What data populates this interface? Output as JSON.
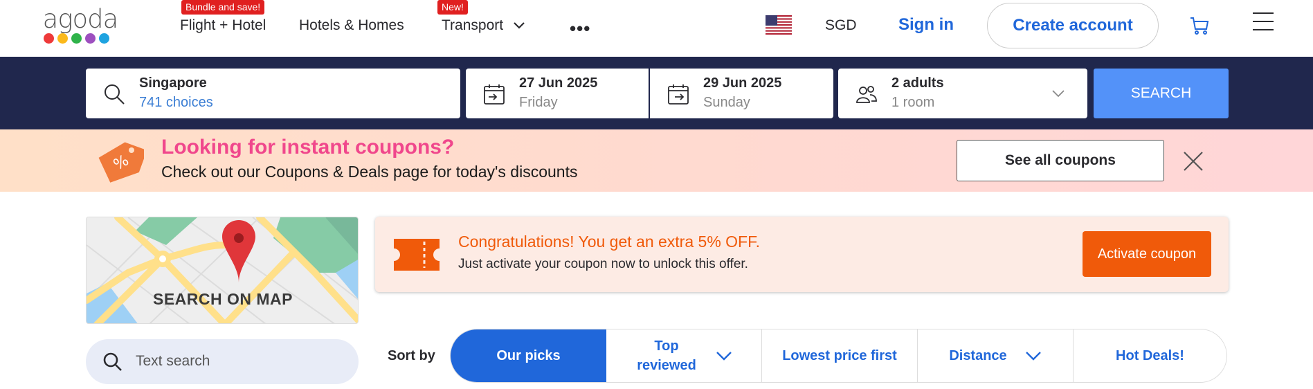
{
  "header": {
    "logo_text": "agoda",
    "logo_dot_colors": [
      "#ee3a3a",
      "#fbb91b",
      "#2fb34a",
      "#9d4fbf",
      "#1ea3e0"
    ],
    "nav": [
      {
        "label": "Flight + Hotel",
        "badge": "Bundle and save!"
      },
      {
        "label": "Hotels & Homes"
      },
      {
        "label": "Transport",
        "badge": "New!"
      }
    ],
    "more_label": "•••",
    "currency": "SGD",
    "sign_in": "Sign in",
    "create_account": "Create account"
  },
  "search": {
    "destination": "Singapore",
    "destination_sub": "741 choices",
    "checkin_date": "27 Jun 2025",
    "checkin_day": "Friday",
    "checkout_date": "29 Jun 2025",
    "checkout_day": "Sunday",
    "guests": "2 adults",
    "rooms": "1 room",
    "button": "SEARCH"
  },
  "coupon_banner": {
    "heading": "Looking for instant coupons?",
    "text": "Check out our Coupons & Deals page for today's discounts",
    "button": "See all coupons"
  },
  "map": {
    "label": "SEARCH ON MAP"
  },
  "text_search": {
    "placeholder": "Text search"
  },
  "promo": {
    "heading": "Congratulations! You get an extra 5% OFF.",
    "text": "Just activate your coupon now to unlock this offer.",
    "button": "Activate coupon"
  },
  "sort": {
    "label": "Sort by",
    "tabs": [
      {
        "label": "Our picks",
        "active": true
      },
      {
        "label": "Top reviewed",
        "dropdown": true
      },
      {
        "label": "Lowest price first"
      },
      {
        "label": "Distance",
        "dropdown": true
      },
      {
        "label": "Hot Deals!"
      }
    ]
  },
  "colors": {
    "brand_blue": "#2067da",
    "search_bar_bg": "#20274d",
    "search_button": "#5392f9",
    "promo_orange": "#f05a0a",
    "coupon_pink": "#f0478c"
  }
}
